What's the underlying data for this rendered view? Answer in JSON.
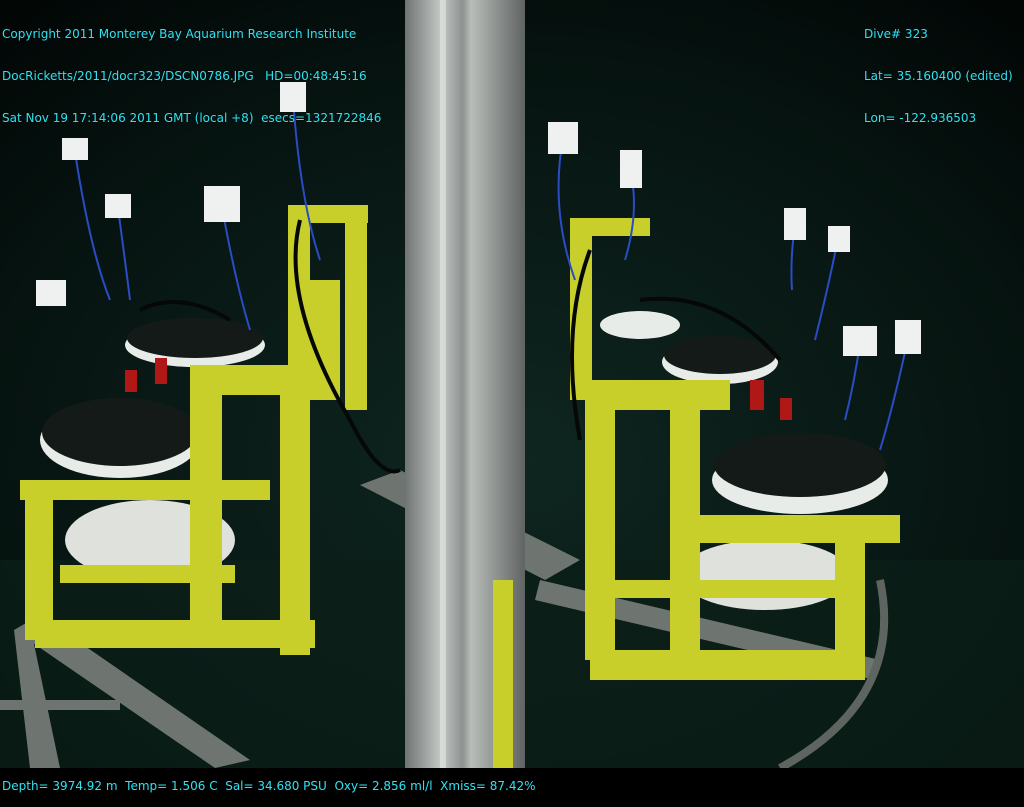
{
  "overlay": {
    "top_left": [
      "Copyright 2011 Monterey Bay Aquarium Research Institute",
      "DocRicketts/2011/docr323/DSCN0786.JPG   HD=00:48:45:16",
      "Sat Nov 19 17:14:06 2011 GMT (local +8)  esecs=1321722846"
    ],
    "top_right": [
      "Dive# 323",
      "Lat= 35.160400 (edited)",
      "Lon= -122.936503"
    ],
    "bottom": "Depth= 3974.92 m  Temp= 1.506 C  Sal= 34.680 PSU  Oxy= 2.856 ml/l  Xmiss= 87.42%"
  },
  "colors": {
    "overlay_text": "#2fe3f2",
    "water": "#071613",
    "frame_yellow": "#c8cf2a",
    "pole": "#a9aeab"
  }
}
